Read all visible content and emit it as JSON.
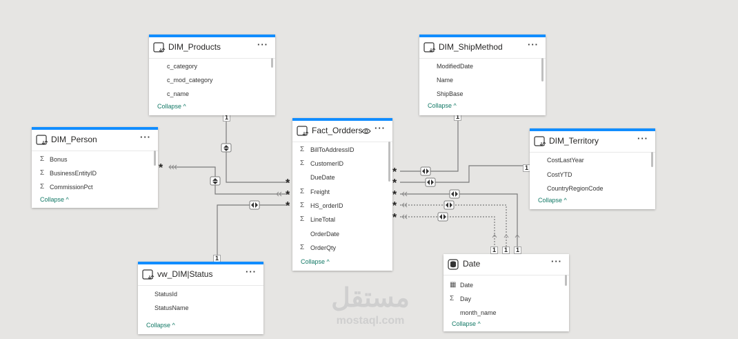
{
  "colors": {
    "accent": "#118dff",
    "link": "#117865",
    "line": "#7a7a7a",
    "canvas": "#e6e5e3"
  },
  "tables": {
    "products": {
      "title": "DIM_Products",
      "fields": [
        {
          "icon": "",
          "name": "c_category"
        },
        {
          "icon": "",
          "name": "c_mod_category"
        },
        {
          "icon": "",
          "name": "c_name"
        }
      ],
      "collapse": "Collapse"
    },
    "shipmethod": {
      "title": "DIM_ShipMethod",
      "fields": [
        {
          "icon": "",
          "name": "ModifiedDate"
        },
        {
          "icon": "",
          "name": "Name"
        },
        {
          "icon": "",
          "name": "ShipBase"
        }
      ],
      "collapse": "Collapse"
    },
    "person": {
      "title": "DIM_Person",
      "fields": [
        {
          "icon": "Σ",
          "name": "Bonus"
        },
        {
          "icon": "Σ",
          "name": "BusinessEntityID"
        },
        {
          "icon": "Σ",
          "name": "CommissionPct"
        }
      ],
      "collapse": "Collapse"
    },
    "fact": {
      "title": "Fact_Ordders",
      "fields": [
        {
          "icon": "Σ",
          "name": "BillToAddressID"
        },
        {
          "icon": "Σ",
          "name": "CustomerID"
        },
        {
          "icon": "",
          "name": "DueDate"
        },
        {
          "icon": "Σ",
          "name": "Freight"
        },
        {
          "icon": "Σ",
          "name": "HS_orderID"
        },
        {
          "icon": "Σ",
          "name": "LineTotal"
        },
        {
          "icon": "",
          "name": "OrderDate"
        },
        {
          "icon": "Σ",
          "name": "OrderQty"
        }
      ],
      "collapse": "Collapse"
    },
    "territory": {
      "title": "DIM_Territory",
      "fields": [
        {
          "icon": "",
          "name": "CostLastYear"
        },
        {
          "icon": "",
          "name": "CostYTD"
        },
        {
          "icon": "",
          "name": "CountryRegionCode"
        }
      ],
      "collapse": "Collapse"
    },
    "status": {
      "title": "vw_DIM|Status",
      "fields": [
        {
          "icon": "",
          "name": "StatusId"
        },
        {
          "icon": "",
          "name": "StatusName"
        }
      ],
      "collapse": "Collapse"
    },
    "date": {
      "title": "Date",
      "fields": [
        {
          "icon": "▦",
          "name": "Date"
        },
        {
          "icon": "Σ",
          "name": "Day"
        },
        {
          "icon": "",
          "name": "month_name"
        }
      ],
      "collapse": "Collapse"
    }
  },
  "labels": {
    "more": "···",
    "one": "1",
    "many": "*",
    "caret": "^"
  },
  "watermark": {
    "logo": "مستقل",
    "site": "mostaql.com"
  }
}
